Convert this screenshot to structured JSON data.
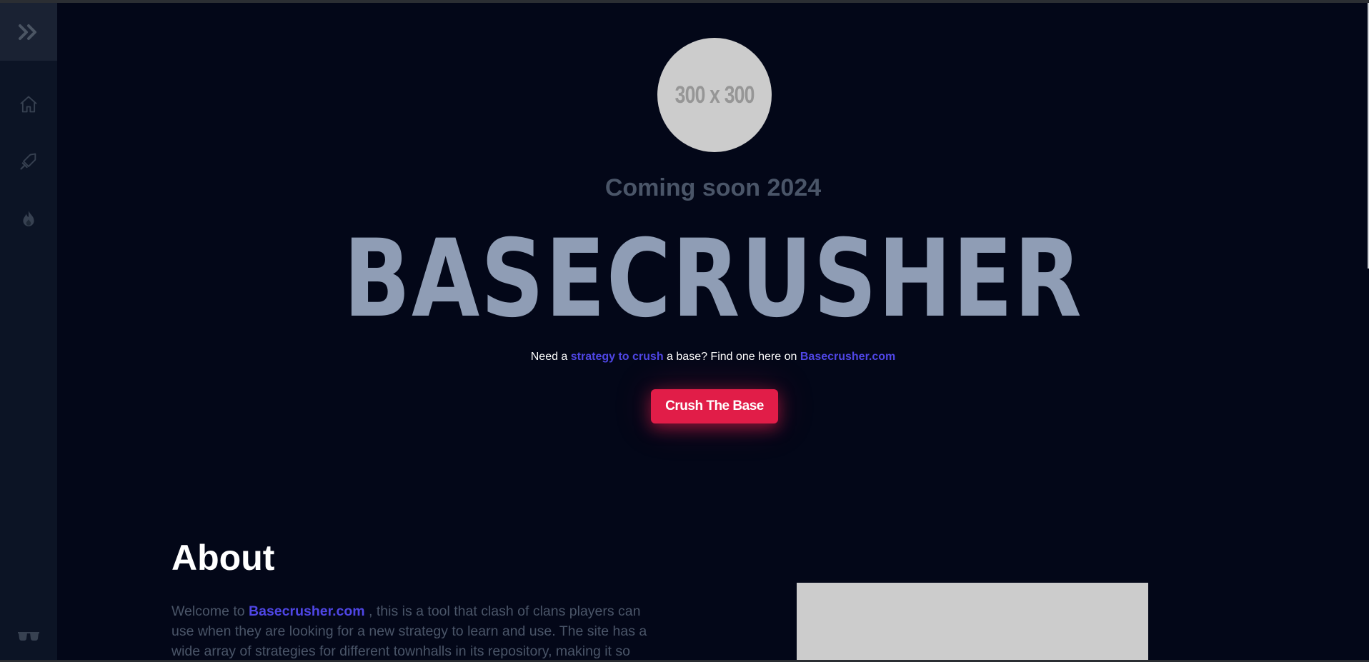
{
  "sidebar": {
    "toggle_icon": "double-chevron-right-icon",
    "items": [
      {
        "icon": "home-icon"
      },
      {
        "icon": "sword-icon"
      },
      {
        "icon": "flame-icon"
      }
    ],
    "footer_icon": "glasses-icon"
  },
  "hero": {
    "avatar_text": "300 x 300",
    "coming_soon": "Coming soon 2024",
    "brand": "BASECRUSHER",
    "tagline": {
      "pre": "Need a",
      "accent1": "strategy to crush",
      "mid": "a base? Find one here on",
      "accent2": "Basecrusher.com"
    },
    "cta_label": "Crush The Base"
  },
  "about": {
    "title": "About",
    "text_pre": "Welcome to",
    "text_link": "Basecrusher.com",
    "text_post": ", this is a tool that clash of clans players can use when they are looking for a new strategy to learn and use. The site has a wide array of strategies for different townhalls in its repository, making it so"
  },
  "colors": {
    "background": "#030718",
    "sidebar": "#0c1425",
    "accent": "#4f46e5",
    "cta": "#e11d48",
    "brand_text": "#8f9db5",
    "muted_text": "#4a5568"
  }
}
